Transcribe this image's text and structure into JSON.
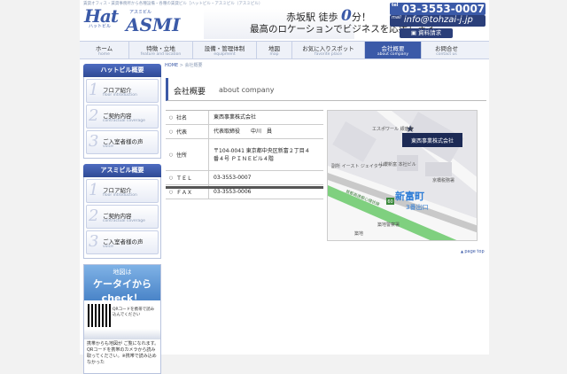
{
  "header": {
    "tagline": "賃貸オフィス・賃貸事務所から各種設備・各種の賃貸ビル［ハットビル・アスミビル（アスミビル）",
    "logo_hat": "Hat",
    "logo_hat_sub": "ハットビル",
    "logo_asmi": "ASMI",
    "logo_asmi_sub": "アスミビル",
    "station": "赤坂駅 徒歩",
    "station_num": "0",
    "station_suffix": "分！",
    "catch": "最高のロケーションでビジネスを応援します。",
    "tel_label": "tel",
    "tel": "03-3553-0007",
    "mail_label": "mail",
    "mail": "info@tohzai-j.jp",
    "download": "資料請求"
  },
  "nav": [
    {
      "jp": "ホーム",
      "en": "home"
    },
    {
      "jp": "特徴・立地",
      "en": "feature and location"
    },
    {
      "jp": "設備・管理体制",
      "en": "equipment"
    },
    {
      "jp": "地図",
      "en": "map"
    },
    {
      "jp": "お気に入りスポット",
      "en": "favorite place"
    },
    {
      "jp": "会社概要",
      "en": "about company"
    },
    {
      "jp": "お問合せ",
      "en": "contact us"
    }
  ],
  "sidebar": {
    "hat_title": "ハットビル概要",
    "asmi_title": "アスミビル概要",
    "hat_items": [
      {
        "num": "1",
        "jp": "フロア紹介",
        "en": "floor introduction"
      },
      {
        "num": "2",
        "jp": "ご契約内容",
        "en": "contractual coverage"
      },
      {
        "num": "3",
        "jp": "ご入室者様の声",
        "en": "voice"
      }
    ],
    "asmi_items": [
      {
        "num": "1",
        "jp": "フロア紹介",
        "en": "floor introduction"
      },
      {
        "num": "2",
        "jp": "ご契約内容",
        "en": "contractual coverage"
      },
      {
        "num": "3",
        "jp": "ご入室者様の声",
        "en": "voice"
      }
    ],
    "ktai_small": "地図は",
    "ktai_big": "ケータイから",
    "ktai_check": "check！",
    "qr_text": "QRコードを携帯で読み込んでください",
    "ktai_note": "携帯からも地図が ご覧になれます。QRコードを携帯のカメラから読み取ってください。※携帯で読み込めなかった"
  },
  "breadcrumb": {
    "home": "HOME",
    "sep": " > ",
    "current": "会社概要"
  },
  "page": {
    "title_jp": "会社概要",
    "title_en": "about company"
  },
  "company": [
    {
      "label": "社名",
      "value": "東西事業株式会社"
    },
    {
      "label": "代表",
      "value": "代表取締役　　中川　員"
    },
    {
      "label": "住所",
      "value": "〒104-0041 東京都中央区新富２丁目４番４号 ＰＩＮＥビル４階"
    },
    {
      "label": "ＴＥＬ",
      "value": "03-3553-0007"
    },
    {
      "label": "ＦＡＸ",
      "value": "03-3553-0006"
    }
  ],
  "map": {
    "company_label": "東西事業株式会社",
    "labels": [
      "エスポワール 銀座東",
      "副所 イースト ジェイタワー",
      "山櫻新富 本社ビル",
      "京橋税務署",
      "新富町",
      "3番出口",
      "築地警察署",
      "首都高速都心環状線",
      "築地"
    ],
    "route": "60"
  },
  "pagetop": "page top"
}
